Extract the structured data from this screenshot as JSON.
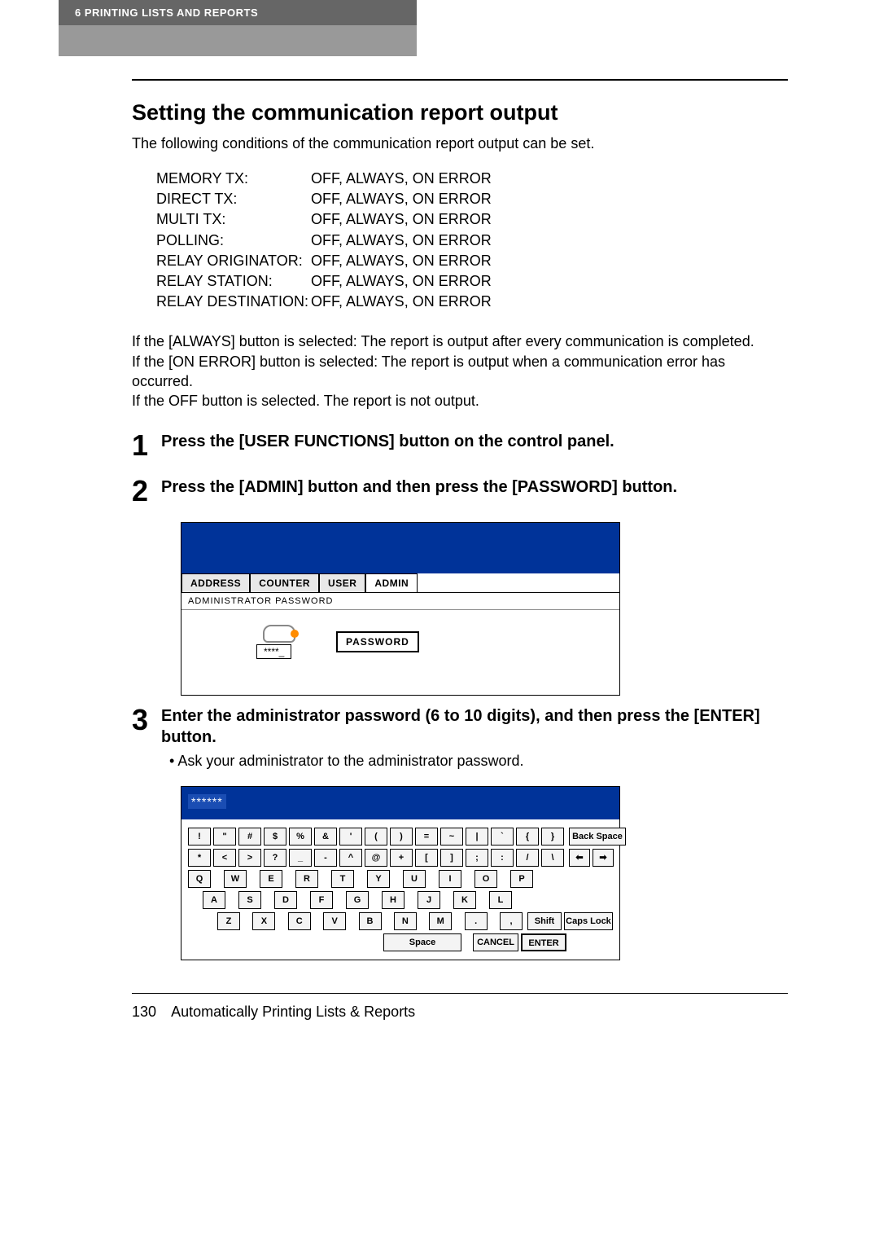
{
  "header": {
    "chapter": "6   PRINTING LISTS AND REPORTS"
  },
  "section_title": "Setting the communication report output",
  "intro": "The following conditions of the communication report output can be set.",
  "settings": [
    {
      "label": "MEMORY TX:",
      "value": "OFF, ALWAYS, ON ERROR"
    },
    {
      "label": "DIRECT TX:",
      "value": "OFF, ALWAYS, ON ERROR"
    },
    {
      "label": "MULTI TX:",
      "value": "OFF, ALWAYS, ON ERROR"
    },
    {
      "label": "POLLING:",
      "value": "OFF, ALWAYS, ON ERROR"
    },
    {
      "label": "RELAY ORIGINATOR:",
      "value": "OFF, ALWAYS, ON ERROR"
    },
    {
      "label": "RELAY STATION:",
      "value": "OFF, ALWAYS, ON ERROR"
    },
    {
      "label": "RELAY DESTINATION:",
      "value": "OFF, ALWAYS, ON ERROR"
    }
  ],
  "notes": [
    "If the [ALWAYS] button is selected: The report is output after every communication is completed.",
    "If the [ON ERROR] button is selected: The report is output when a communication error has occurred.",
    "If the OFF button is selected. The report is not output."
  ],
  "steps": {
    "s1": {
      "num": "1",
      "title": "Press the [USER FUNCTIONS] button on the control panel."
    },
    "s2": {
      "num": "2",
      "title": "Press the [ADMIN] button and then press the [PASSWORD] button."
    },
    "s3": {
      "num": "3",
      "title": "Enter the administrator password (6 to 10 digits), and then press the [ENTER] button.",
      "bullet": "Ask your administrator to the administrator password."
    }
  },
  "screenshot1": {
    "tabs": [
      "ADDRESS",
      "COUNTER",
      "USER",
      "ADMIN"
    ],
    "subhead": "ADMINISTRATOR PASSWORD",
    "stars": "****_",
    "pwd_button": "PASSWORD"
  },
  "screenshot2": {
    "entry": "******",
    "row1": [
      "!",
      "\"",
      "#",
      "$",
      "%",
      "&",
      "'",
      "(",
      ")",
      "=",
      "~",
      "|",
      "`",
      "{",
      "}"
    ],
    "row1_back": "Back Space",
    "row2": [
      "*",
      "<",
      ">",
      "?",
      "_",
      "-",
      "^",
      "@",
      "+",
      "[",
      "]",
      ";",
      ":",
      "/",
      "\\"
    ],
    "row2_left": "⬅",
    "row2_right": "➡",
    "row3": [
      "Q",
      "W",
      "E",
      "R",
      "T",
      "Y",
      "U",
      "I",
      "O",
      "P"
    ],
    "row4": [
      "A",
      "S",
      "D",
      "F",
      "G",
      "H",
      "J",
      "K",
      "L"
    ],
    "row5": [
      "Z",
      "X",
      "C",
      "V",
      "B",
      "N",
      "M",
      ".",
      ","
    ],
    "shift": "Shift",
    "caps": "Caps Lock",
    "space": "Space",
    "cancel": "CANCEL",
    "enter": "ENTER"
  },
  "footer": {
    "page": "130",
    "title": "Automatically Printing Lists & Reports"
  }
}
